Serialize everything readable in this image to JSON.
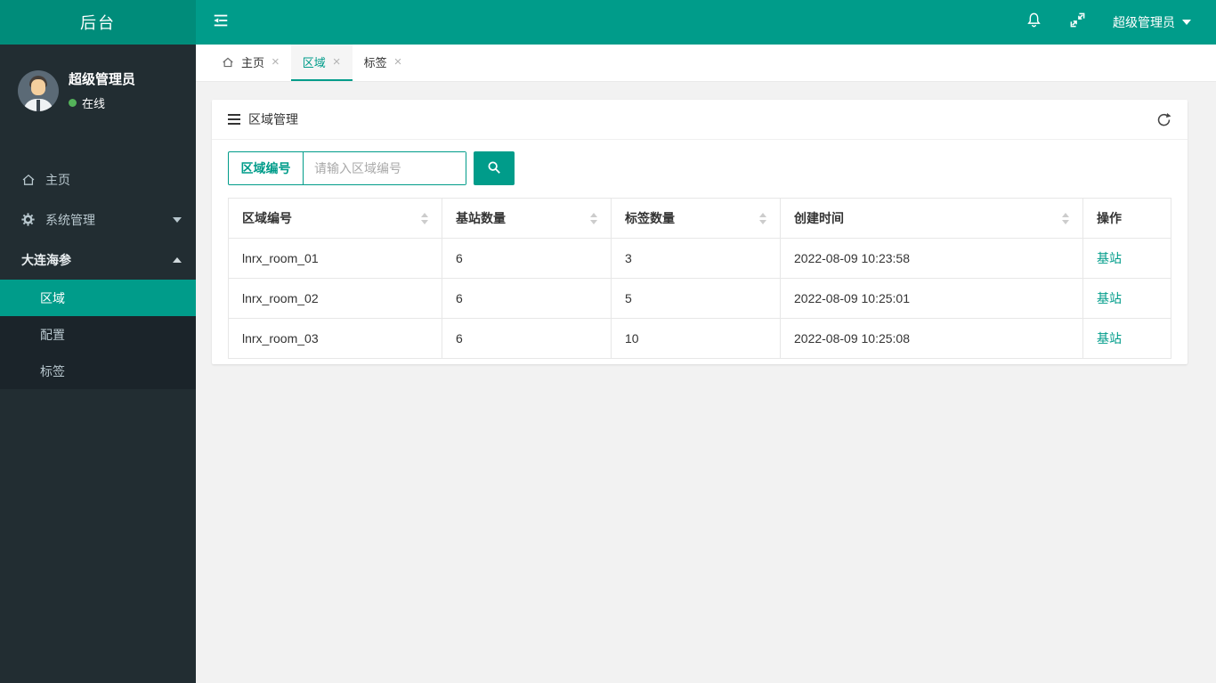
{
  "branding": {
    "logo_text": "后台"
  },
  "navbar": {
    "user_name": "超级管理员"
  },
  "sidebar": {
    "user_name": "超级管理员",
    "user_status": "在线",
    "items": {
      "home": "主页",
      "system": "系统管理",
      "dalian": "大连海参"
    },
    "submenu": {
      "region": "区域",
      "config": "配置",
      "tag": "标签"
    }
  },
  "tabs": [
    {
      "label": "主页"
    },
    {
      "label": "区域"
    },
    {
      "label": "标签"
    }
  ],
  "icons": {
    "close": "×"
  },
  "card": {
    "title": "区域管理",
    "search": {
      "label": "区域编号",
      "placeholder": "请输入区域编号"
    },
    "table": {
      "columns": [
        {
          "label": "区域编号"
        },
        {
          "label": "基站数量"
        },
        {
          "label": "标签数量"
        },
        {
          "label": "创建时间"
        },
        {
          "label": "操作"
        }
      ],
      "rows": [
        {
          "region_id": "lnrx_room_01",
          "station_count": "6",
          "tag_count": "3",
          "created_at": "2022-08-09 10:23:58",
          "action": "基站"
        },
        {
          "region_id": "lnrx_room_02",
          "station_count": "6",
          "tag_count": "5",
          "created_at": "2022-08-09 10:25:01",
          "action": "基站"
        },
        {
          "region_id": "lnrx_room_03",
          "station_count": "6",
          "tag_count": "10",
          "created_at": "2022-08-09 10:25:08",
          "action": "基站"
        }
      ]
    }
  },
  "colors": {
    "accent": "#009c8a",
    "logo_bg": "#008c7a",
    "sidebar_bg": "#222d32",
    "submenu_bg": "#1b242a",
    "status_dot": "#54b35a"
  }
}
